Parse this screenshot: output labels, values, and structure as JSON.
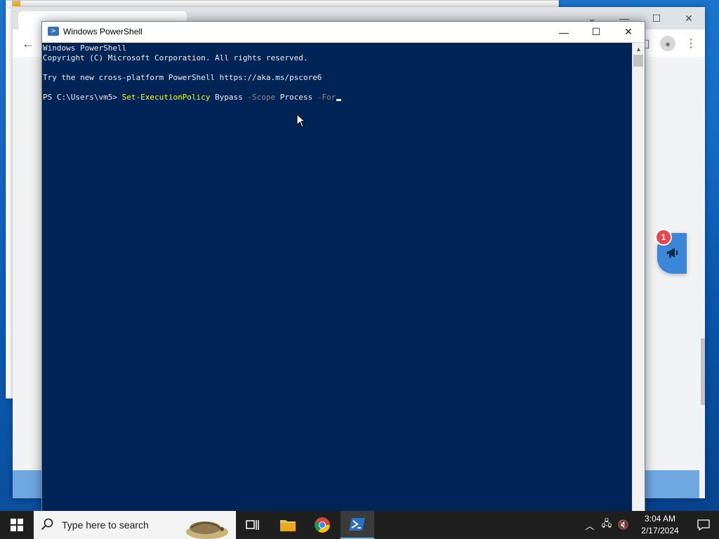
{
  "background_chrome": {
    "notification_badge_count": "1"
  },
  "powershell": {
    "title": "Windows PowerShell",
    "console_lines": {
      "line1": "Windows PowerShell",
      "line2": "Copyright (C) Microsoft Corporation. All rights reserved.",
      "line3": "",
      "line4": "Try the new cross-platform PowerShell https://aka.ms/pscore6",
      "line5": ""
    },
    "prompt": {
      "path": "PS C:\\Users\\vm5> ",
      "cmdlet": "Set-ExecutionPolicy",
      "arg1": " Bypass ",
      "param1": "-Scope",
      "arg2": " Process ",
      "param2": "-For"
    }
  },
  "taskbar": {
    "search_placeholder": "Type here to search",
    "time": "3:04 AM",
    "date": "2/17/2024",
    "accent": "#76b9ed"
  },
  "colors": {
    "console_bg": "#012456",
    "console_fg": "#eeedf0",
    "cmdlet": "#ffff00",
    "parameter": "#8a8a8a"
  }
}
